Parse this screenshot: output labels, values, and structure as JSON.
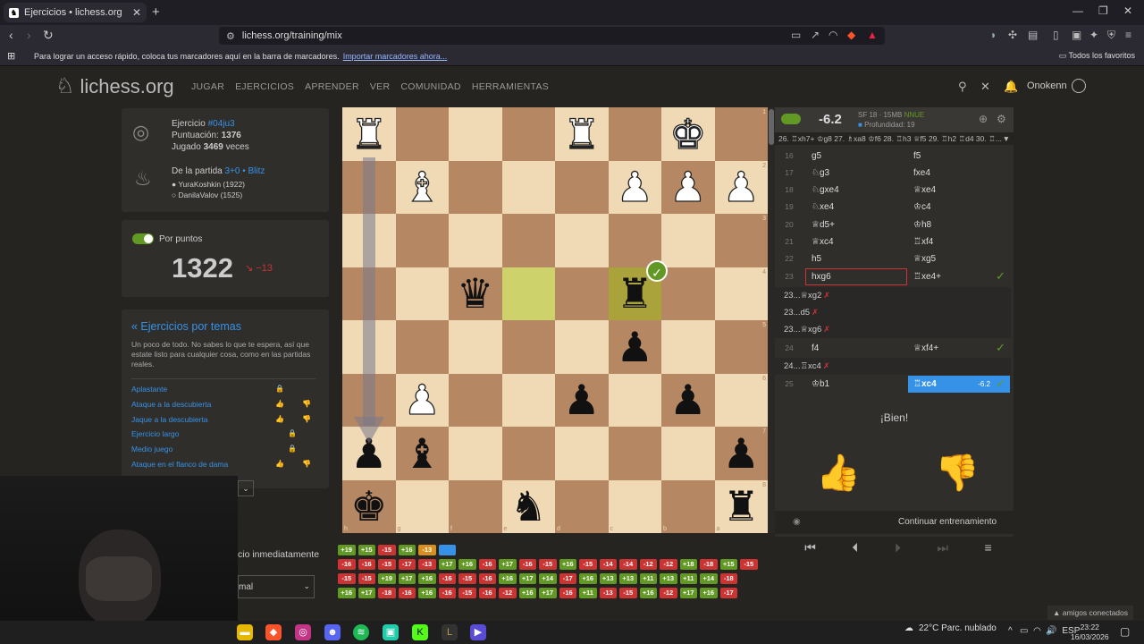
{
  "browser": {
    "tab_title": "Ejercicios • lichess.org",
    "url": "lichess.org/training/mix",
    "bookmarks_msg": "Para lograr un acceso rápido, coloca tus marcadores aquí en la barra de marcadores.",
    "bookmarks_link": "Importar marcadores ahora...",
    "all_favorites": "Todos los favoritos"
  },
  "site": {
    "logo": "lichess.org",
    "nav": [
      "JUGAR",
      "EJERCICIOS",
      "APRENDER",
      "VER",
      "COMUNIDAD",
      "HERRAMIENTAS"
    ],
    "username": "Onokenn"
  },
  "puzzle": {
    "label": "Ejercicio",
    "id": "#04ju3",
    "rating_label": "Puntuación:",
    "rating": "1376",
    "played_pre": "Jugado",
    "played": "3469",
    "played_post": "veces",
    "game_label": "De la partida",
    "game_type": "3+0 • Blitz",
    "white_player": "YuraKoshkin (1922)",
    "black_player": "DanilaValov (1525)"
  },
  "score": {
    "label": "Por puntos",
    "value": "1322",
    "delta": "−13"
  },
  "themes": {
    "title": "« Ejercicios por temas",
    "desc": "Un poco de todo. No sabes lo que te espera, así que estate listo para cualquier cosa, como en las partidas reales.",
    "items": [
      "Aplastante",
      "Ataque a la descubierta",
      "Jaque a la descubierta",
      "Ejercicio largo",
      "Medio juego",
      "Ataque en el flanco de dama"
    ]
  },
  "settings": {
    "auto_text": "cio inmediatamente",
    "select_value": "mal"
  },
  "board": {
    "ranks": [
      "1",
      "2",
      "3",
      "4",
      "5",
      "6",
      "7",
      "8"
    ],
    "files": [
      "h",
      "g",
      "f",
      "e",
      "d",
      "c",
      "b",
      "a"
    ],
    "rows": [
      [
        "wR",
        "",
        "",
        "",
        "wR",
        "",
        "wK",
        ""
      ],
      [
        "",
        "wB",
        "",
        "",
        "",
        "wP",
        "wP",
        "wP"
      ],
      [
        "",
        "",
        "",
        "",
        "",
        "",
        "",
        ""
      ],
      [
        "",
        "",
        "bQ",
        "",
        "",
        "bR",
        "",
        ""
      ],
      [
        "",
        "",
        "",
        "",
        "",
        "bP",
        "",
        ""
      ],
      [
        "",
        "wP",
        "",
        "",
        "bP",
        "",
        "bP",
        ""
      ],
      [
        "bP",
        "bB",
        "",
        "",
        "",
        "",
        "",
        "bP"
      ],
      [
        "bK",
        "",
        "",
        "bN",
        "",
        "",
        "",
        "bR"
      ]
    ]
  },
  "engine": {
    "eval": "-6.2",
    "name": "SF 18 · 15MB",
    "nnue": "NNUE",
    "depth": "Profundidad: 19",
    "pv": "26. ♖xh7+ ♔g8 27. ♗xa8 ♔f6 28. ♖h3 ♕f5 29. ♖h2 ♖d4 30. ♖..."
  },
  "moves": [
    {
      "n": "16",
      "w": "g5",
      "b": "f5"
    },
    {
      "n": "17",
      "w": "♘g3",
      "b": "fxe4"
    },
    {
      "n": "18",
      "w": "♘gxe4",
      "b": "♕xe4"
    },
    {
      "n": "19",
      "w": "♘xe4",
      "b": "♔c4"
    },
    {
      "n": "20",
      "w": "♕d5+",
      "b": "♔h8"
    },
    {
      "n": "21",
      "w": "♕xc4",
      "b": "♖xf4"
    },
    {
      "n": "22",
      "w": "h5",
      "b": "♕xg5"
    },
    {
      "n": "23",
      "w": "hxg6",
      "b": "♖xe4+"
    },
    {
      "n": "24",
      "w": "f4",
      "b": "♕xf4+"
    },
    {
      "n": "25",
      "w": "♔b1",
      "b": "♖xc4",
      "ev": "-6.2"
    }
  ],
  "fails": [
    {
      "n": "23...",
      "m": "♕xg2"
    },
    {
      "n": "23...",
      "m": "d5"
    },
    {
      "n": "23...",
      "m": "♕xg6"
    },
    {
      "n": "24...",
      "m": "♖xc4"
    }
  ],
  "feedback": {
    "bien": "¡Bien!",
    "continue": "Continuar entrenamiento"
  },
  "history": [
    [
      [
        "+19",
        "g"
      ],
      [
        "+15",
        "g"
      ],
      [
        "-15",
        "r"
      ],
      [
        "+16",
        "g"
      ],
      [
        "-13",
        "o"
      ],
      [
        "",
        "bl"
      ]
    ],
    [
      [
        "-16",
        "r"
      ],
      [
        "-16",
        "r"
      ],
      [
        "-15",
        "r"
      ],
      [
        "-17",
        "r"
      ],
      [
        "-13",
        "r"
      ],
      [
        "+17",
        "g"
      ],
      [
        "+16",
        "g"
      ],
      [
        "-16",
        "r"
      ],
      [
        "+17",
        "g"
      ],
      [
        "-16",
        "r"
      ],
      [
        "-15",
        "r"
      ],
      [
        "+16",
        "g"
      ],
      [
        "-15",
        "r"
      ],
      [
        "-14",
        "r"
      ],
      [
        "-14",
        "r"
      ],
      [
        "-12",
        "r"
      ],
      [
        "-12",
        "r"
      ],
      [
        "+18",
        "g"
      ],
      [
        "-18",
        "r"
      ],
      [
        "+15",
        "g"
      ],
      [
        "-15",
        "r"
      ]
    ],
    [
      [
        "-15",
        "r"
      ],
      [
        "-15",
        "r"
      ],
      [
        "+19",
        "g"
      ],
      [
        "+17",
        "g"
      ],
      [
        "+16",
        "g"
      ],
      [
        "-16",
        "r"
      ],
      [
        "-15",
        "r"
      ],
      [
        "-16",
        "r"
      ],
      [
        "+16",
        "g"
      ],
      [
        "+17",
        "g"
      ],
      [
        "+14",
        "g"
      ],
      [
        "-17",
        "r"
      ],
      [
        "+16",
        "g"
      ],
      [
        "+13",
        "g"
      ],
      [
        "+13",
        "g"
      ],
      [
        "+11",
        "g"
      ],
      [
        "+13",
        "g"
      ],
      [
        "+11",
        "g"
      ],
      [
        "+14",
        "g"
      ],
      [
        "-18",
        "r"
      ]
    ],
    [
      [
        "+16",
        "g"
      ],
      [
        "+17",
        "g"
      ],
      [
        "-18",
        "r"
      ],
      [
        "-16",
        "r"
      ],
      [
        "+16",
        "g"
      ],
      [
        "-16",
        "r"
      ],
      [
        "-15",
        "r"
      ],
      [
        "-16",
        "r"
      ],
      [
        "-12",
        "r"
      ],
      [
        "+16",
        "g"
      ],
      [
        "+17",
        "g"
      ],
      [
        "-16",
        "r"
      ],
      [
        "+11",
        "g"
      ],
      [
        "-13",
        "r"
      ],
      [
        "-15",
        "r"
      ],
      [
        "+16",
        "g"
      ],
      [
        "-12",
        "r"
      ],
      [
        "+17",
        "g"
      ],
      [
        "+16",
        "g"
      ],
      [
        "-17",
        "r"
      ]
    ]
  ],
  "friends": "amigos conectados",
  "taskbar": {
    "weather": "22°C  Parc. nublado",
    "lang": "ESP",
    "time": "23:22",
    "date": "16/03/2026"
  }
}
